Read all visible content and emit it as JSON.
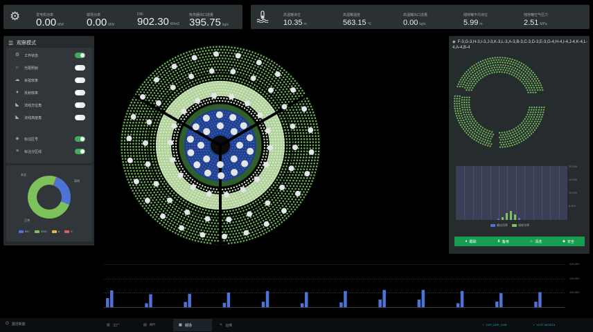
{
  "top_left": {
    "metrics": [
      {
        "label": "发电机功率",
        "value": "0.00",
        "unit": "MW"
      },
      {
        "label": "镜场功率",
        "value": "0.00",
        "unit": "MW"
      },
      {
        "label": "DNI",
        "value": "902.30",
        "unit": "W/m2"
      },
      {
        "label": "吸热器出口流量",
        "value": "395.75",
        "unit": "kg/s"
      }
    ]
  },
  "top_right": {
    "metrics": [
      {
        "label": "高温罐液位",
        "value": "10.35",
        "unit": "m"
      },
      {
        "label": "高温罐温度",
        "value": "563.15",
        "unit": "℃"
      },
      {
        "label": "高温罐出口流量",
        "value": "0.00",
        "unit": "kg/s"
      },
      {
        "label": "储存罐平均液位",
        "value": "5.99",
        "unit": "m"
      },
      {
        "label": "储存罐空气压力",
        "value": "2.51",
        "unit": "MPa"
      }
    ]
  },
  "left_panel": {
    "title": "观察模式",
    "modes": [
      {
        "icon": "gear-icon",
        "glyph": "⚙",
        "label": "工作状态",
        "on": true
      },
      {
        "icon": "sun-icon",
        "glyph": "☼",
        "label": "光斑照射",
        "on": false
      },
      {
        "icon": "cloud-icon",
        "glyph": "☁",
        "label": "余弦效率",
        "on": false
      },
      {
        "icon": "bulb-icon",
        "glyph": "♦",
        "label": "反射效率",
        "on": false
      },
      {
        "icon": "chart-icon",
        "glyph": "◣",
        "label": "法线方位角",
        "on": false
      },
      {
        "icon": "chart-icon",
        "glyph": "◣",
        "label": "法线高度角",
        "on": false
      }
    ],
    "region": [
      {
        "icon": "tag-icon",
        "glyph": "◈",
        "label": "标注区号",
        "on": true
      },
      {
        "icon": "list-icon",
        "glyph": "≡",
        "label": "标注分区线",
        "on": true
      }
    ],
    "donut": {
      "labels": {
        "top": "安全",
        "right": "离线",
        "bottom": "正常"
      },
      "values": [
        {
          "name": "遮挡",
          "value": 857,
          "color": "#4f72d6"
        },
        {
          "name": "正常",
          "value": 2540,
          "color": "#7dc15b"
        },
        {
          "name": "故障",
          "value": 8,
          "color": "#f0b73a"
        },
        {
          "name": "离线",
          "value": 8,
          "color": "#e25a5a"
        }
      ],
      "legend": [
        {
          "value": "857",
          "color": "#4f72d6"
        },
        {
          "value": "2540",
          "color": "#7dc15b"
        },
        {
          "value": "8",
          "color": "#f0b73a"
        },
        {
          "value": "8",
          "color": "#e25a5a"
        }
      ]
    }
  },
  "right_panel": {
    "zone_codes": "F-3,G-3,H-3,I-3,J-3,K-3,L-3,A-3,B-3,C-3,D-3,E-3,G-4,H-4,I-4,J-4,K-4,L-4,A-4,B-4",
    "chart_y": [
      "20,000",
      "15,000",
      "10,000",
      "5,000"
    ],
    "chart_legend": [
      {
        "label": "输出功率",
        "color": "#4f72d6"
      },
      {
        "label": "吸收功率",
        "color": "#7dc15b"
      }
    ],
    "buttons": [
      {
        "icon": "play-icon",
        "glyph": "●",
        "label": "跟踪"
      },
      {
        "icon": "hourglass-icon",
        "glyph": "⧗",
        "label": "备用"
      },
      {
        "icon": "clean-icon",
        "glyph": "♨",
        "label": "清洗"
      },
      {
        "icon": "shield-icon",
        "glyph": "◆",
        "label": "安全"
      }
    ],
    "accent": "#169d4f"
  },
  "bottom_chart": {
    "y_ticks": [
      "200,000",
      "150,000",
      "100,000"
    ],
    "chart_data": {
      "type": "bar",
      "series": [
        {
          "values": [
            42000,
            18000,
            24000,
            20000,
            25000,
            18000,
            22000,
            35000,
            35000,
            18000,
            26000,
            25000,
            35000
          ]
        },
        {
          "values": [
            78000,
            60000,
            62000,
            68000,
            75000,
            70000,
            75000,
            80000,
            80000,
            75000,
            65000,
            70000,
            90000
          ]
        }
      ],
      "ylim": [
        0,
        200000
      ]
    }
  },
  "footer": {
    "left_label": "激活新能",
    "tabs": [
      {
        "label": "工厂",
        "icon": "factory-icon",
        "glyph": "▥",
        "active": false
      },
      {
        "label": "API",
        "icon": "doc-icon",
        "glyph": "▤",
        "active": false
      },
      {
        "label": "镜场",
        "icon": "grid-icon",
        "glyph": "▦",
        "active": true
      },
      {
        "label": "运维",
        "icon": "tool-icon",
        "glyph": "✎",
        "active": false
      }
    ],
    "status": [
      "CHP_UDP_1108",
      "10.37.48.53/13"
    ]
  }
}
